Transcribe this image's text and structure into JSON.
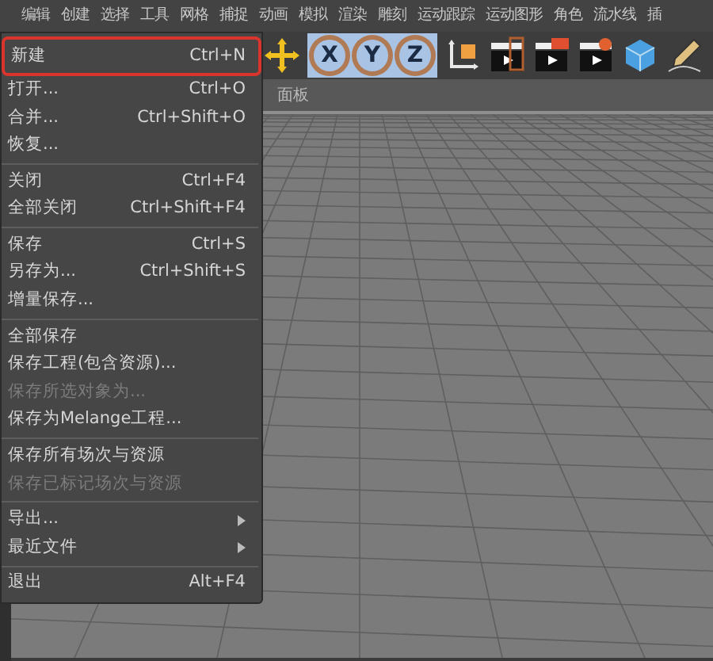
{
  "menubar": [
    "编辑",
    "创建",
    "选择",
    "工具",
    "网格",
    "捕捉",
    "动画",
    "模拟",
    "渲染",
    "雕刻",
    "运动跟踪",
    "运动图形",
    "角色",
    "流水线",
    "插"
  ],
  "toolbar": {
    "axis_buttons": [
      {
        "label": "X",
        "selected": true
      },
      {
        "label": "Y",
        "selected": true
      },
      {
        "label": "Z",
        "selected": true
      }
    ]
  },
  "viewport": {
    "menu": "面板"
  },
  "file_menu": {
    "items": [
      {
        "kind": "item",
        "label": "新建",
        "shortcut": "Ctrl+N",
        "highlighted": true,
        "disabled": false,
        "submenu": false
      },
      {
        "kind": "item",
        "label": "打开...",
        "shortcut": "Ctrl+O",
        "highlighted": false,
        "disabled": false,
        "submenu": false
      },
      {
        "kind": "item",
        "label": "合并...",
        "shortcut": "Ctrl+Shift+O",
        "highlighted": false,
        "disabled": false,
        "submenu": false
      },
      {
        "kind": "item",
        "label": "恢复...",
        "highlighted": false,
        "disabled": false,
        "submenu": false
      },
      {
        "kind": "separator"
      },
      {
        "kind": "item",
        "label": "关闭",
        "shortcut": "Ctrl+F4",
        "highlighted": false,
        "disabled": false,
        "submenu": false
      },
      {
        "kind": "item",
        "label": "全部关闭",
        "shortcut": "Ctrl+Shift+F4",
        "highlighted": false,
        "disabled": false,
        "submenu": false
      },
      {
        "kind": "separator"
      },
      {
        "kind": "item",
        "label": "保存",
        "shortcut": "Ctrl+S",
        "highlighted": false,
        "disabled": false,
        "submenu": false
      },
      {
        "kind": "item",
        "label": "另存为...",
        "shortcut": "Ctrl+Shift+S",
        "highlighted": false,
        "disabled": false,
        "submenu": false
      },
      {
        "kind": "item",
        "label": "增量保存...",
        "highlighted": false,
        "disabled": false,
        "submenu": false
      },
      {
        "kind": "separator"
      },
      {
        "kind": "item",
        "label": "全部保存",
        "highlighted": false,
        "disabled": false,
        "submenu": false
      },
      {
        "kind": "item",
        "label": "保存工程(包含资源)...",
        "highlighted": false,
        "disabled": false,
        "submenu": false
      },
      {
        "kind": "item",
        "label": "保存所选对象为...",
        "highlighted": false,
        "disabled": true,
        "submenu": false
      },
      {
        "kind": "item",
        "label": "保存为Melange工程...",
        "highlighted": false,
        "disabled": false,
        "submenu": false
      },
      {
        "kind": "separator"
      },
      {
        "kind": "item",
        "label": "保存所有场次与资源",
        "highlighted": false,
        "disabled": false,
        "submenu": false
      },
      {
        "kind": "item",
        "label": "保存已标记场次与资源",
        "highlighted": false,
        "disabled": true,
        "submenu": false
      },
      {
        "kind": "separator"
      },
      {
        "kind": "item",
        "label": "导出...",
        "highlighted": false,
        "disabled": false,
        "submenu": true
      },
      {
        "kind": "item",
        "label": "最近文件",
        "highlighted": false,
        "disabled": false,
        "submenu": true
      },
      {
        "kind": "separator"
      },
      {
        "kind": "item",
        "label": "退出",
        "shortcut": "Alt+F4",
        "highlighted": false,
        "disabled": false,
        "submenu": false
      }
    ]
  }
}
